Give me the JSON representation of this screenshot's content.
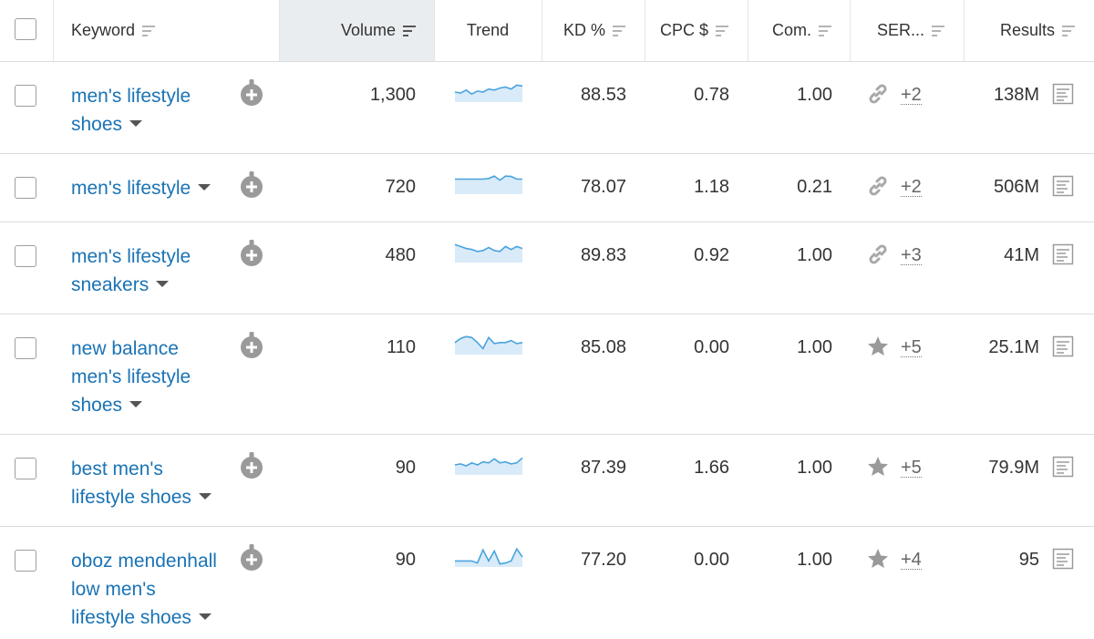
{
  "header": {
    "keyword": "Keyword",
    "volume": "Volume",
    "trend": "Trend",
    "kd": "KD %",
    "cpc": "CPC $",
    "com": "Com.",
    "serp": "SER...",
    "results": "Results"
  },
  "colors": {
    "link": "#1a73b5",
    "trend_line": "#4aa3df",
    "trend_fill": "#d9ebf9",
    "sorted_column_bg": "#e9edf0"
  },
  "rows": [
    {
      "keyword_lines": [
        "men's lifestyle",
        "shoes"
      ],
      "volume": "1,300",
      "trend": [
        0.5,
        0.45,
        0.6,
        0.4,
        0.55,
        0.5,
        0.65,
        0.6,
        0.7,
        0.75,
        0.65,
        0.85,
        0.8
      ],
      "kd": "88.53",
      "cpc": "0.78",
      "com": "1.00",
      "serp_icon": "link-icon",
      "serp_more": "+2",
      "results": "138M"
    },
    {
      "keyword_lines": [
        "men's lifestyle"
      ],
      "volume": "720",
      "trend": [
        0.75,
        0.75,
        0.75,
        0.75,
        0.75,
        0.75,
        0.78,
        0.9,
        0.7,
        0.9,
        0.88,
        0.75,
        0.75
      ],
      "kd": "78.07",
      "cpc": "1.18",
      "com": "0.21",
      "serp_icon": "link-icon",
      "serp_more": "+2",
      "results": "506M"
    },
    {
      "keyword_lines": [
        "men's lifestyle",
        "sneakers"
      ],
      "volume": "480",
      "trend": [
        0.9,
        0.8,
        0.7,
        0.65,
        0.55,
        0.6,
        0.75,
        0.6,
        0.55,
        0.8,
        0.65,
        0.8,
        0.7
      ],
      "kd": "89.83",
      "cpc": "0.92",
      "com": "1.00",
      "serp_icon": "link-icon",
      "serp_more": "+3",
      "results": "41M"
    },
    {
      "keyword_lines": [
        "new balance",
        "men's lifestyle",
        "shoes"
      ],
      "volume": "110",
      "trend": [
        0.6,
        0.8,
        0.9,
        0.85,
        0.6,
        0.3,
        0.85,
        0.55,
        0.6,
        0.6,
        0.7,
        0.55,
        0.6
      ],
      "kd": "85.08",
      "cpc": "0.00",
      "com": "1.00",
      "serp_icon": "star-icon",
      "serp_more": "+5",
      "results": "25.1M"
    },
    {
      "keyword_lines": [
        "best men's",
        "lifestyle shoes"
      ],
      "volume": "90",
      "trend": [
        0.5,
        0.55,
        0.45,
        0.6,
        0.5,
        0.65,
        0.6,
        0.8,
        0.6,
        0.65,
        0.55,
        0.6,
        0.85
      ],
      "kd": "87.39",
      "cpc": "1.66",
      "com": "1.00",
      "serp_icon": "star-icon",
      "serp_more": "+5",
      "results": "79.9M"
    },
    {
      "keyword_lines": [
        "oboz mendenhall",
        "low men's",
        "lifestyle shoes"
      ],
      "volume": "90",
      "trend": [
        0.3,
        0.3,
        0.3,
        0.3,
        0.2,
        0.85,
        0.3,
        0.8,
        0.15,
        0.2,
        0.3,
        0.9,
        0.5
      ],
      "kd": "77.20",
      "cpc": "0.00",
      "com": "1.00",
      "serp_icon": "star-icon",
      "serp_more": "+4",
      "results": "95"
    }
  ]
}
